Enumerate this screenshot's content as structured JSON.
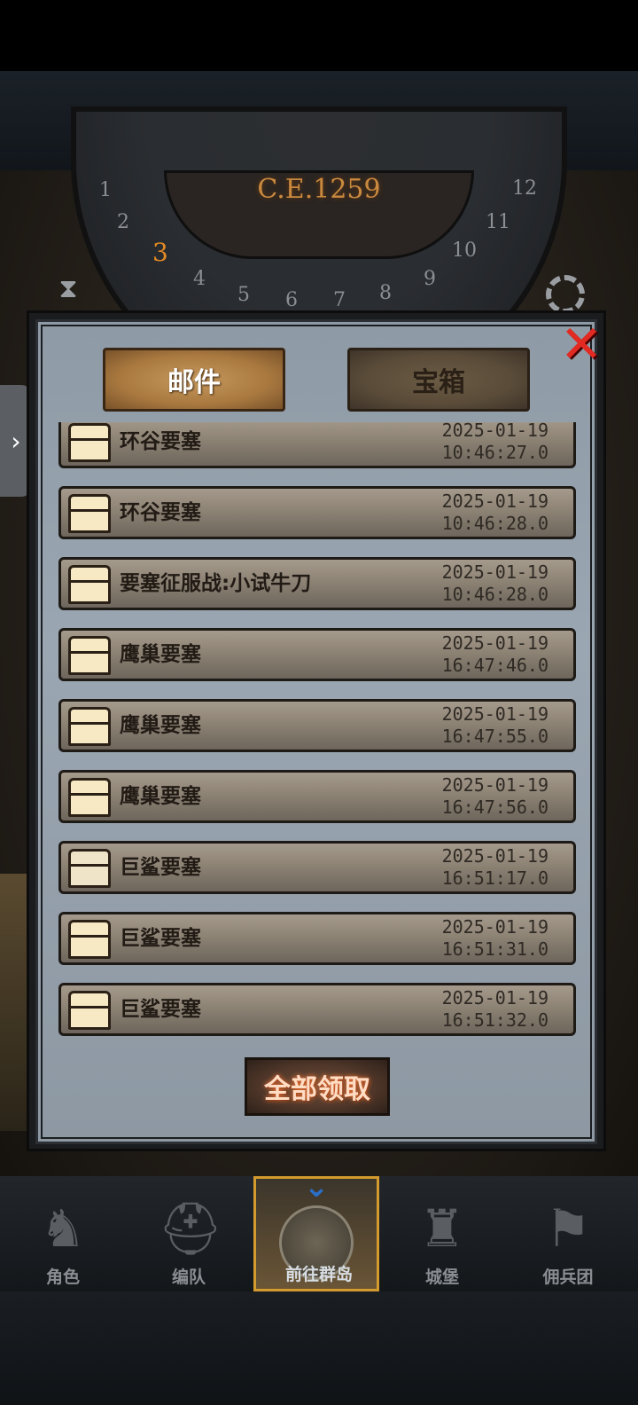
{
  "hud": {
    "year": "C.E.1259",
    "dial_numbers": [
      "1",
      "2",
      "3",
      "4",
      "5",
      "6",
      "7",
      "8",
      "9",
      "10",
      "11",
      "12"
    ],
    "active_dial_number": "3"
  },
  "mail_panel": {
    "tabs": [
      {
        "label": "邮件",
        "active": true
      },
      {
        "label": "宝箱",
        "active": false
      }
    ],
    "messages": [
      {
        "title": "环谷要塞",
        "date": "2025-01-19",
        "time": "10:46:27.0",
        "icon": "chest-icon"
      },
      {
        "title": "环谷要塞",
        "date": "2025-01-19",
        "time": "10:46:28.0",
        "icon": "chest-icon"
      },
      {
        "title": "要塞征服战:小试牛刀",
        "date": "2025-01-19",
        "time": "10:46:28.0",
        "icon": "chest-icon"
      },
      {
        "title": "鹰巢要塞",
        "date": "2025-01-19",
        "time": "16:47:46.0",
        "icon": "chest-icon"
      },
      {
        "title": "鹰巢要塞",
        "date": "2025-01-19",
        "time": "16:47:55.0",
        "icon": "chest-icon"
      },
      {
        "title": "鹰巢要塞",
        "date": "2025-01-19",
        "time": "16:47:56.0",
        "icon": "chest-icon"
      },
      {
        "title": "巨鲨要塞",
        "date": "2025-01-19",
        "time": "16:51:17.0",
        "icon": "closed-chest-icon"
      },
      {
        "title": "巨鲨要塞",
        "date": "2025-01-19",
        "time": "16:51:31.0",
        "icon": "chest-icon"
      },
      {
        "title": "巨鲨要塞",
        "date": "2025-01-19",
        "time": "16:51:32.0",
        "icon": "chest-icon"
      }
    ],
    "claim_all_label": "全部领取"
  },
  "bottom_nav": {
    "items": [
      {
        "label": "角色",
        "icon": "knight-icon",
        "active": false
      },
      {
        "label": "编队",
        "icon": "helmet-icon",
        "active": false
      },
      {
        "label": "前往群岛",
        "icon": "globe-icon",
        "active": true
      },
      {
        "label": "城堡",
        "icon": "castle-icon",
        "active": false
      },
      {
        "label": "佣兵团",
        "icon": "banner-icon",
        "active": false
      }
    ]
  },
  "colors": {
    "accent_gold": "#d39a2d",
    "close_red": "#e32a22",
    "claim_glow": "#ff7a3a"
  }
}
